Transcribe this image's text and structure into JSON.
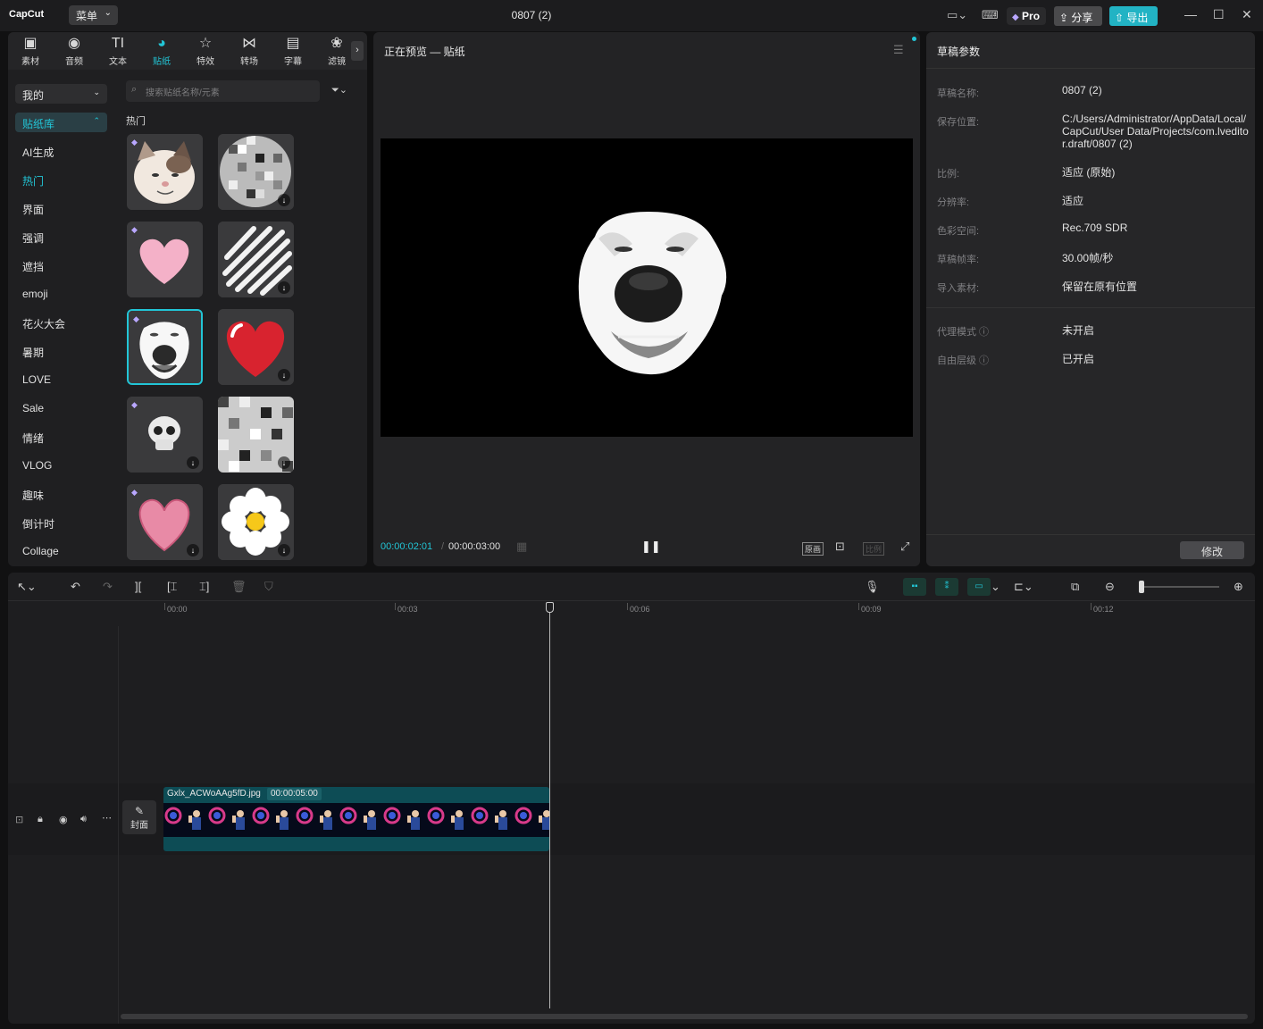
{
  "app": {
    "logo": "CapCut",
    "menu_label": "菜单",
    "project_title": "0807 (2)",
    "pro_label": "Pro",
    "share_label": "分享",
    "export_label": "导出"
  },
  "left_panel": {
    "tabs": [
      {
        "label": "素材",
        "icon": "media-icon",
        "glyph": "▣"
      },
      {
        "label": "音频",
        "icon": "audio-icon",
        "glyph": "◉"
      },
      {
        "label": "文本",
        "icon": "text-icon",
        "glyph": "TI"
      },
      {
        "label": "贴纸",
        "icon": "sticker-icon",
        "glyph": "◕"
      },
      {
        "label": "特效",
        "icon": "effects-icon",
        "glyph": "☆"
      },
      {
        "label": "转场",
        "icon": "transition-icon",
        "glyph": "⋈"
      },
      {
        "label": "字幕",
        "icon": "caption-icon",
        "glyph": "▤"
      },
      {
        "label": "滤镜",
        "icon": "filter-icon",
        "glyph": "❀"
      }
    ],
    "active_tab": "贴纸",
    "mine_label": "我的",
    "library_label": "贴纸库",
    "categories": [
      "AI生成",
      "热门",
      "界面",
      "强调",
      "遮挡",
      "emoji",
      "花火大会",
      "暑期",
      "LOVE",
      "Sale",
      "情绪",
      "VLOG",
      "趣味",
      "倒计时",
      "Collage"
    ],
    "active_category": "热门",
    "search_placeholder": "搜索贴纸名称/元素",
    "section_title": "热门",
    "stickers": [
      {
        "name": "cat-face-sticker",
        "premium": true,
        "download": false
      },
      {
        "name": "pixel-circle-sticker",
        "premium": false,
        "download": true
      },
      {
        "name": "pink-heart-sticker",
        "premium": true,
        "download": false
      },
      {
        "name": "scribble-sticker",
        "premium": false,
        "download": true
      },
      {
        "name": "dog-face-sticker",
        "premium": true,
        "download": false,
        "selected": true
      },
      {
        "name": "red-heart-sticker",
        "premium": false,
        "download": true
      },
      {
        "name": "skull-sticker",
        "premium": true,
        "download": true
      },
      {
        "name": "pixel-square-sticker",
        "premium": false,
        "download": true
      },
      {
        "name": "drawn-heart-sticker",
        "premium": true,
        "download": true
      },
      {
        "name": "daisy-sticker",
        "premium": false,
        "download": true
      }
    ]
  },
  "preview": {
    "title": "正在预览 — 贴纸",
    "current_time": "00:00:02:01",
    "separator": "/",
    "total_time": "00:00:03:00",
    "original_label": "原画",
    "ratio_label": "比例"
  },
  "props": {
    "header": "草稿参数",
    "rows": [
      {
        "label": "草稿名称:",
        "value": "0807 (2)"
      },
      {
        "label": "保存位置:",
        "value": "C:/Users/Administrator/AppData/Local/CapCut/User Data/Projects/com.lveditor.draft/0807 (2)"
      },
      {
        "label": "比例:",
        "value": "适应 (原始)"
      },
      {
        "label": "分辨率:",
        "value": "适应"
      },
      {
        "label": "色彩空间:",
        "value": "Rec.709 SDR"
      },
      {
        "label": "草稿帧率:",
        "value": "30.00帧/秒"
      },
      {
        "label": "导入素材:",
        "value": "保留在原有位置"
      }
    ],
    "extra_rows": [
      {
        "label": "代理模式 ⓘ",
        "value": "未开启"
      },
      {
        "label": "自由层级 ⓘ",
        "value": "已开启"
      }
    ],
    "modify_label": "修改"
  },
  "timeline": {
    "ruler_labels": [
      "00:00",
      "00:03",
      "00:06",
      "00:09",
      "00:12"
    ],
    "cover_label": "封面",
    "clip_name": "Gxlx_ACWoAAg5fD.jpg",
    "clip_duration": "00:00:05:00",
    "accent": "#22c5d6"
  }
}
